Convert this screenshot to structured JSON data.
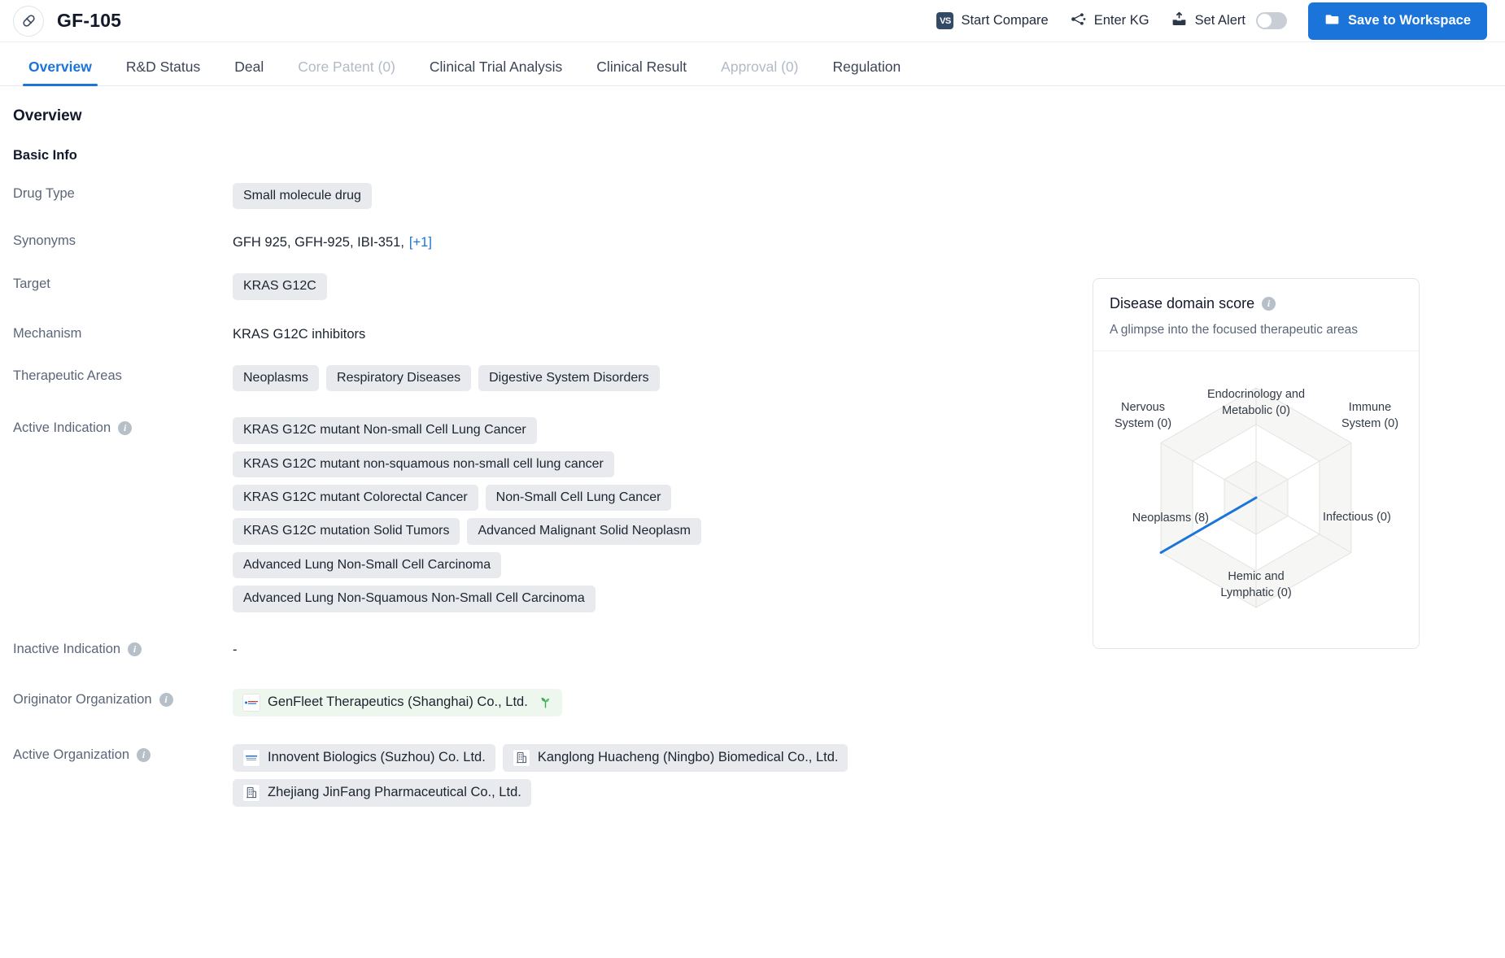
{
  "header": {
    "drug_icon": "pill-icon",
    "title": "GF-105",
    "actions": [
      {
        "id": "start-compare",
        "icon": "vs-icon",
        "label": "Start Compare"
      },
      {
        "id": "enter-kg",
        "icon": "knowledge-graph-icon",
        "label": "Enter KG"
      },
      {
        "id": "set-alert",
        "icon": "alert-inbox-icon",
        "label": "Set Alert",
        "toggle": false
      }
    ],
    "save_button": {
      "icon": "folder-icon",
      "label": "Save to Workspace"
    }
  },
  "tabs": [
    {
      "label": "Overview",
      "active": true,
      "disabled": false
    },
    {
      "label": "R&D Status",
      "active": false,
      "disabled": false
    },
    {
      "label": "Deal",
      "active": false,
      "disabled": false
    },
    {
      "label": "Core Patent (0)",
      "active": false,
      "disabled": true
    },
    {
      "label": "Clinical Trial Analysis",
      "active": false,
      "disabled": false
    },
    {
      "label": "Clinical Result",
      "active": false,
      "disabled": false
    },
    {
      "label": "Approval (0)",
      "active": false,
      "disabled": true
    },
    {
      "label": "Regulation",
      "active": false,
      "disabled": false
    }
  ],
  "page": {
    "section_title": "Overview",
    "subsection_title": "Basic Info"
  },
  "fields": {
    "drug_type": {
      "label": "Drug Type",
      "values": [
        "Small molecule drug"
      ]
    },
    "synonyms": {
      "label": "Synonyms",
      "text": "GFH 925,  GFH-925,  IBI-351,",
      "more": "[+1]"
    },
    "target": {
      "label": "Target",
      "values": [
        "KRAS G12C"
      ]
    },
    "mechanism": {
      "label": "Mechanism",
      "text": "KRAS G12C inhibitors"
    },
    "therapeutic_areas": {
      "label": "Therapeutic Areas",
      "values": [
        "Neoplasms",
        "Respiratory Diseases",
        "Digestive System Disorders"
      ]
    },
    "active_indication": {
      "label": "Active Indication",
      "info": "info-icon",
      "values": [
        "KRAS G12C mutant Non-small Cell Lung Cancer",
        "KRAS G12C mutant non-squamous non-small cell lung cancer",
        "KRAS G12C mutant Colorectal Cancer",
        "Non-Small Cell Lung Cancer",
        "KRAS G12C mutation Solid Tumors",
        "Advanced Malignant Solid Neoplasm",
        "Advanced Lung Non-Small Cell Carcinoma",
        "Advanced Lung Non-Squamous Non-Small Cell Carcinoma"
      ]
    },
    "inactive_indication": {
      "label": "Inactive Indication",
      "info": "info-icon",
      "text": "-"
    },
    "originator_organization": {
      "label": "Originator Organization",
      "info": "info-icon",
      "values": [
        {
          "name": "GenFleet Therapeutics (Shanghai) Co., Ltd.",
          "logo": "company-logo",
          "badge": "sprout-icon",
          "highlight": true
        }
      ]
    },
    "active_organization": {
      "label": "Active Organization",
      "info": "info-icon",
      "values": [
        {
          "name": "Innovent Biologics (Suzhou) Co. Ltd.",
          "logo": "company-logo",
          "badge": null,
          "highlight": false
        },
        {
          "name": "Kanglong Huacheng (Ningbo) Biomedical Co., Ltd.",
          "logo": "building-icon",
          "badge": null,
          "highlight": false
        },
        {
          "name": "Zhejiang JinFang Pharmaceutical Co., Ltd.",
          "logo": "building-icon",
          "badge": null,
          "highlight": false
        }
      ]
    }
  },
  "score_card": {
    "title": "Disease domain score",
    "info": "info-icon",
    "subtitle": "A glimpse into the focused therapeutic areas"
  },
  "chart_data": {
    "type": "radar",
    "title": "Disease domain score",
    "subtitle": "A glimpse into the focused therapeutic areas",
    "categories": [
      "Endocrinology and Metabolic",
      "Immune System",
      "Infectious",
      "Hemic and Lymphatic",
      "Neoplasms",
      "Nervous System"
    ],
    "tick_labels": [
      "Endocrinology and\nMetabolic (0)",
      "Immune\nSystem (0)",
      "Infectious (0)",
      "Hemic and\nLymphatic (0)",
      "Neoplasms (8)",
      "Nervous\nSystem (0)"
    ],
    "values": [
      0,
      0,
      0,
      0,
      8,
      0
    ],
    "rmax": 8,
    "rings": 3,
    "grid": true,
    "legend": false,
    "series_color": "#1a74d9",
    "grid_color": "#e2e2e0"
  }
}
